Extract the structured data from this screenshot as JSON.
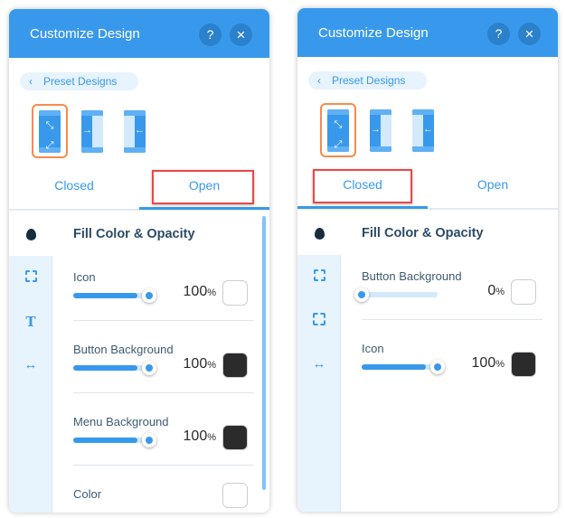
{
  "panels": [
    {
      "title": "Customize Design",
      "help_icon": "?",
      "close_icon": "×",
      "preset_label": "Preset Designs",
      "tabs": [
        "Closed",
        "Open"
      ],
      "active_tab": 1,
      "highlighted_tab": 1,
      "section_title": "Fill Color & Opacity",
      "rail_icons": [
        "drop-icon",
        "dashed-square-icon",
        "text-icon",
        "arrows-horizontal-icon"
      ],
      "items": [
        {
          "label": "Icon",
          "value": 100,
          "unit": "%",
          "swatch": "#ffffff"
        },
        {
          "label": "Button Background",
          "value": 100,
          "unit": "%",
          "swatch": "#2b2b2b"
        },
        {
          "label": "Menu Background",
          "value": 100,
          "unit": "%",
          "swatch": "#2b2b2b"
        },
        {
          "label": "Color",
          "swatch": "#ffffff"
        }
      ],
      "scrollbar": true
    },
    {
      "title": "Customize Design",
      "help_icon": "?",
      "close_icon": "×",
      "preset_label": "Preset Designs",
      "tabs": [
        "Closed",
        "Open"
      ],
      "active_tab": 0,
      "highlighted_tab": 0,
      "section_title": "Fill Color & Opacity",
      "rail_icons": [
        "drop-icon",
        "dashed-square-icon",
        "corners-square-icon",
        "arrows-horizontal-icon"
      ],
      "items": [
        {
          "label": "Button Background",
          "value": 0,
          "unit": "%",
          "swatch": "#ffffff"
        },
        {
          "label": "Icon",
          "value": 100,
          "unit": "%",
          "swatch": "#2b2b2b"
        }
      ],
      "scrollbar": false
    }
  ],
  "colors": {
    "accent": "#3899ec",
    "selected_layout": "#f68b4d",
    "highlight": "#e94848"
  }
}
